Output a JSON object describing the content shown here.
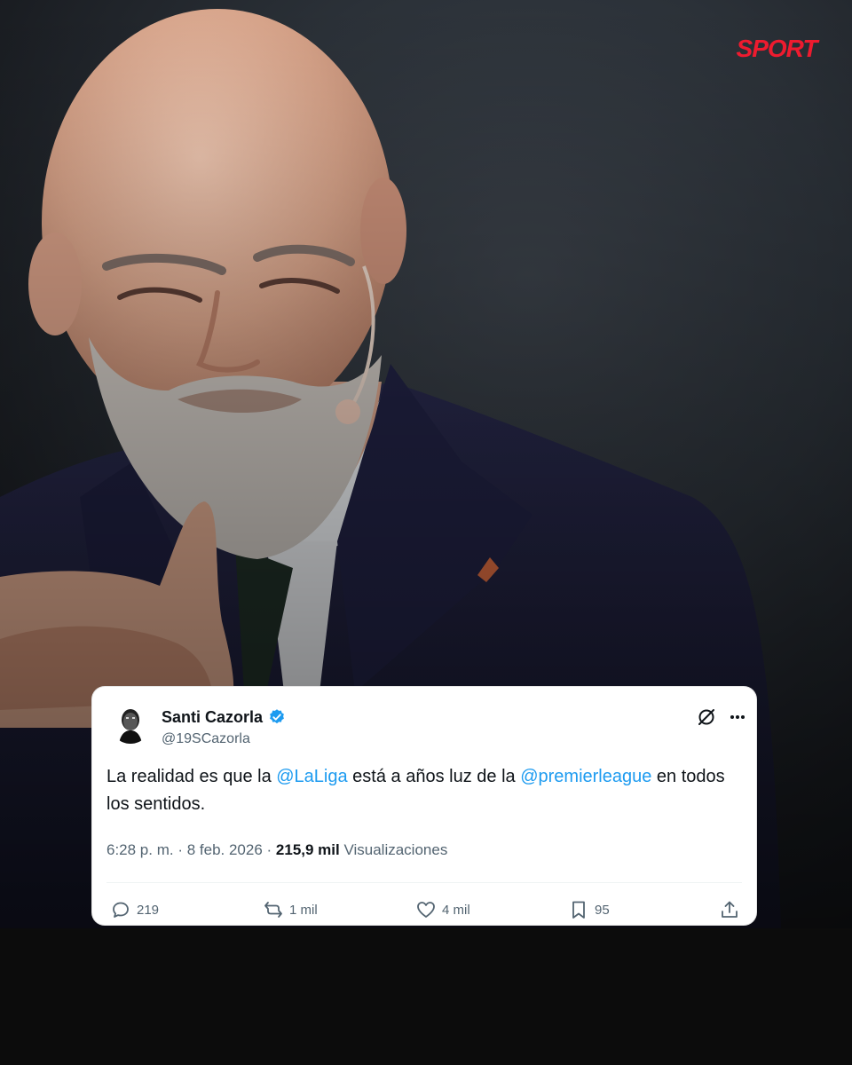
{
  "brand": {
    "logo_text": "SPORT",
    "color": "#ee1b2f"
  },
  "tweet": {
    "author": {
      "name": "Santi Cazorla",
      "handle": "@19SCazorla",
      "verified": true,
      "avatar_icon": "avatar-portrait-icon"
    },
    "text_parts": {
      "p1": "La realidad es que la ",
      "mention1": "@LaLiga",
      "p2": " está a años luz de la ",
      "mention2": "@premierleague",
      "p3": " en todos los sentidos."
    },
    "meta": {
      "time": "6:28 p. m.",
      "sep1": " · ",
      "date": "8 feb. 2026",
      "sep2": " · ",
      "views_count": "215,9 mil",
      "views_label": " Visualizaciones"
    },
    "actions": {
      "replies": "219",
      "reposts": "1 mil",
      "likes": "4 mil",
      "bookmarks": "95"
    },
    "icons": {
      "grok": "grok-icon",
      "more": "more-icon",
      "reply": "reply-icon",
      "repost": "repost-icon",
      "like": "heart-icon",
      "bookmark": "bookmark-icon",
      "share": "share-icon"
    }
  },
  "colors": {
    "link": "#1d9bf0",
    "text": "#0f1419",
    "muted": "#536471",
    "verified": "#1d9bf0"
  }
}
